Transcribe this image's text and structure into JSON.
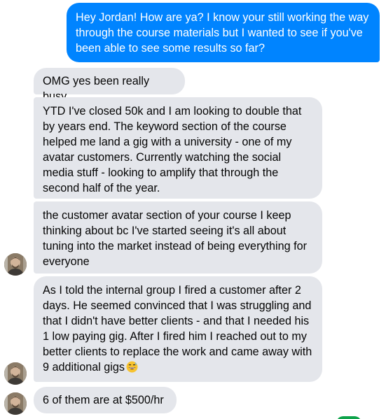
{
  "conversation": {
    "messages": [
      {
        "sender": "me",
        "text": "Hey Jordan! How are ya? I know your still working the way through the course materials but I wanted to see if you've been able to see some results so far?"
      },
      {
        "sender": "jordan",
        "text": "OMG yes been really busy"
      },
      {
        "sender": "jordan",
        "text": "YTD I've closed 50k and I am looking to double that by years end. The keyword section of the course helped me land a gig with a university - one of my avatar customers. Currently watching the social media stuff - looking to amplify that through the second half of the year."
      },
      {
        "sender": "jordan",
        "text": "the customer avatar section of your course I keep thinking about bc I've started seeing it's all about tuning into the market instead of being everything for everyone"
      },
      {
        "sender": "jordan",
        "text": "As I told the internal group I fired a customer after 2 days. He seemed convinced that I was struggling and that I didn't have better clients - and that I needed his 1 low paying gig. After I fired him I reached out to my better clients to replace the work and came away with 9 additional gigs",
        "emoji": "grinning-sweat-emoji"
      },
      {
        "sender": "jordan",
        "text": "6 of them are at $500/hr"
      }
    ]
  },
  "colors": {
    "outgoing_bubble": "#0084ff",
    "incoming_bubble": "#e4e6eb",
    "outgoing_text": "#ffffff",
    "incoming_text": "#050505"
  }
}
